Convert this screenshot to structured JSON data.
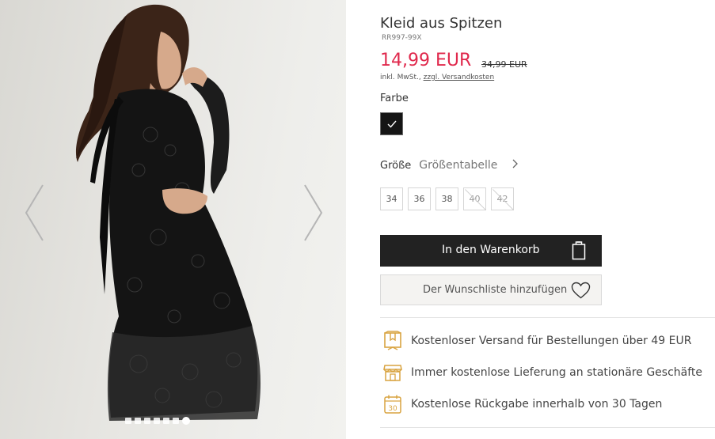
{
  "gallery": {
    "prev_icon": "chevron-left-icon",
    "next_icon": "chevron-right-icon",
    "dot_count": 7,
    "active_dot": 6
  },
  "product": {
    "title": "Kleid aus Spitzen",
    "sku": "RR997-99X",
    "price": "14,99 EUR",
    "old_price": "34,99 EUR",
    "tax_prefix": "inkl. MwSt., ",
    "tax_link": "zzgl. Versandkosten",
    "price_color": "#e0284c"
  },
  "color": {
    "label": "Farbe",
    "selected_swatch": "#151515"
  },
  "size": {
    "label": "Größe",
    "chart_link": "Größentabelle",
    "options": [
      {
        "label": "34",
        "available": true
      },
      {
        "label": "36",
        "available": true
      },
      {
        "label": "38",
        "available": true
      },
      {
        "label": "40",
        "available": false
      },
      {
        "label": "42",
        "available": false
      }
    ]
  },
  "actions": {
    "add_to_cart": "In den Warenkorb",
    "cart_icon": "shopping-bag-icon",
    "wishlist": "Der Wunschliste hinzufügen",
    "wishlist_icon": "heart-icon"
  },
  "benefits": [
    {
      "icon": "shipping-box-icon",
      "text": "Kostenloser Versand für Bestellungen über 49 EUR"
    },
    {
      "icon": "store-icon",
      "text": "Immer kostenlose Lieferung an stationäre Geschäfte"
    },
    {
      "icon": "calendar-30-icon",
      "text": "Kostenlose Rückgabe innerhalb von 30 Tagen"
    }
  ],
  "accent_color": "#d9a441"
}
